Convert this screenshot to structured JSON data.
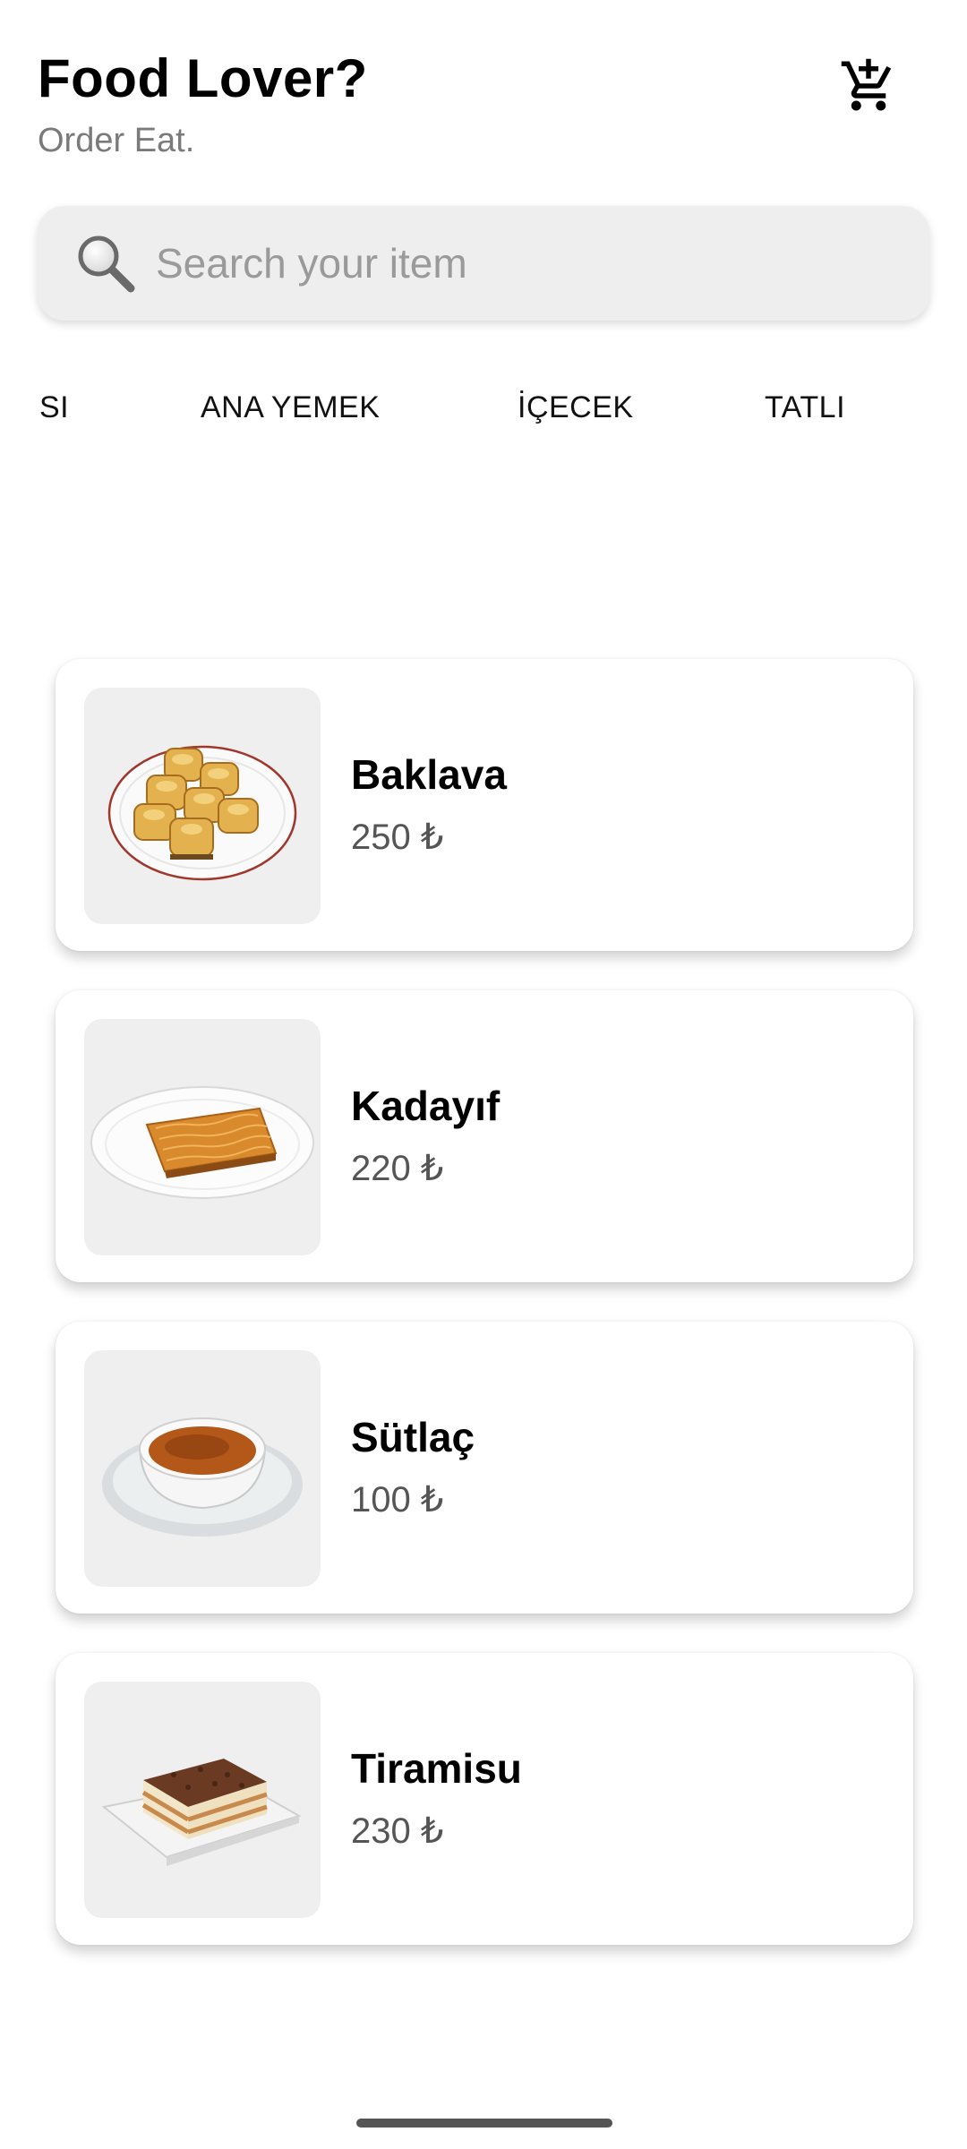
{
  "header": {
    "title": "Food Lover?",
    "subtitle": "Order Eat."
  },
  "icons": {
    "cart": "add-shopping-cart-icon",
    "search": "magnifier-icon"
  },
  "search": {
    "placeholder": "Search your item",
    "value": ""
  },
  "tabs": [
    {
      "label": "SI"
    },
    {
      "label": "ANA YEMEK"
    },
    {
      "label": "İÇECEK"
    },
    {
      "label": "TATLI"
    }
  ],
  "products": [
    {
      "name": "Baklava",
      "price": "250 ₺",
      "image": "baklava-plate"
    },
    {
      "name": "Kadayıf",
      "price": "220 ₺",
      "image": "kadayif-plate"
    },
    {
      "name": "Sütlaç",
      "price": "100 ₺",
      "image": "sutlac-bowl"
    },
    {
      "name": "Tiramisu",
      "price": "230 ₺",
      "image": "tiramisu-slice"
    }
  ],
  "colors": {
    "accent": "#000000",
    "search_bg": "#eeeeee",
    "thumb_bg": "#efefef",
    "price": "#555555"
  }
}
